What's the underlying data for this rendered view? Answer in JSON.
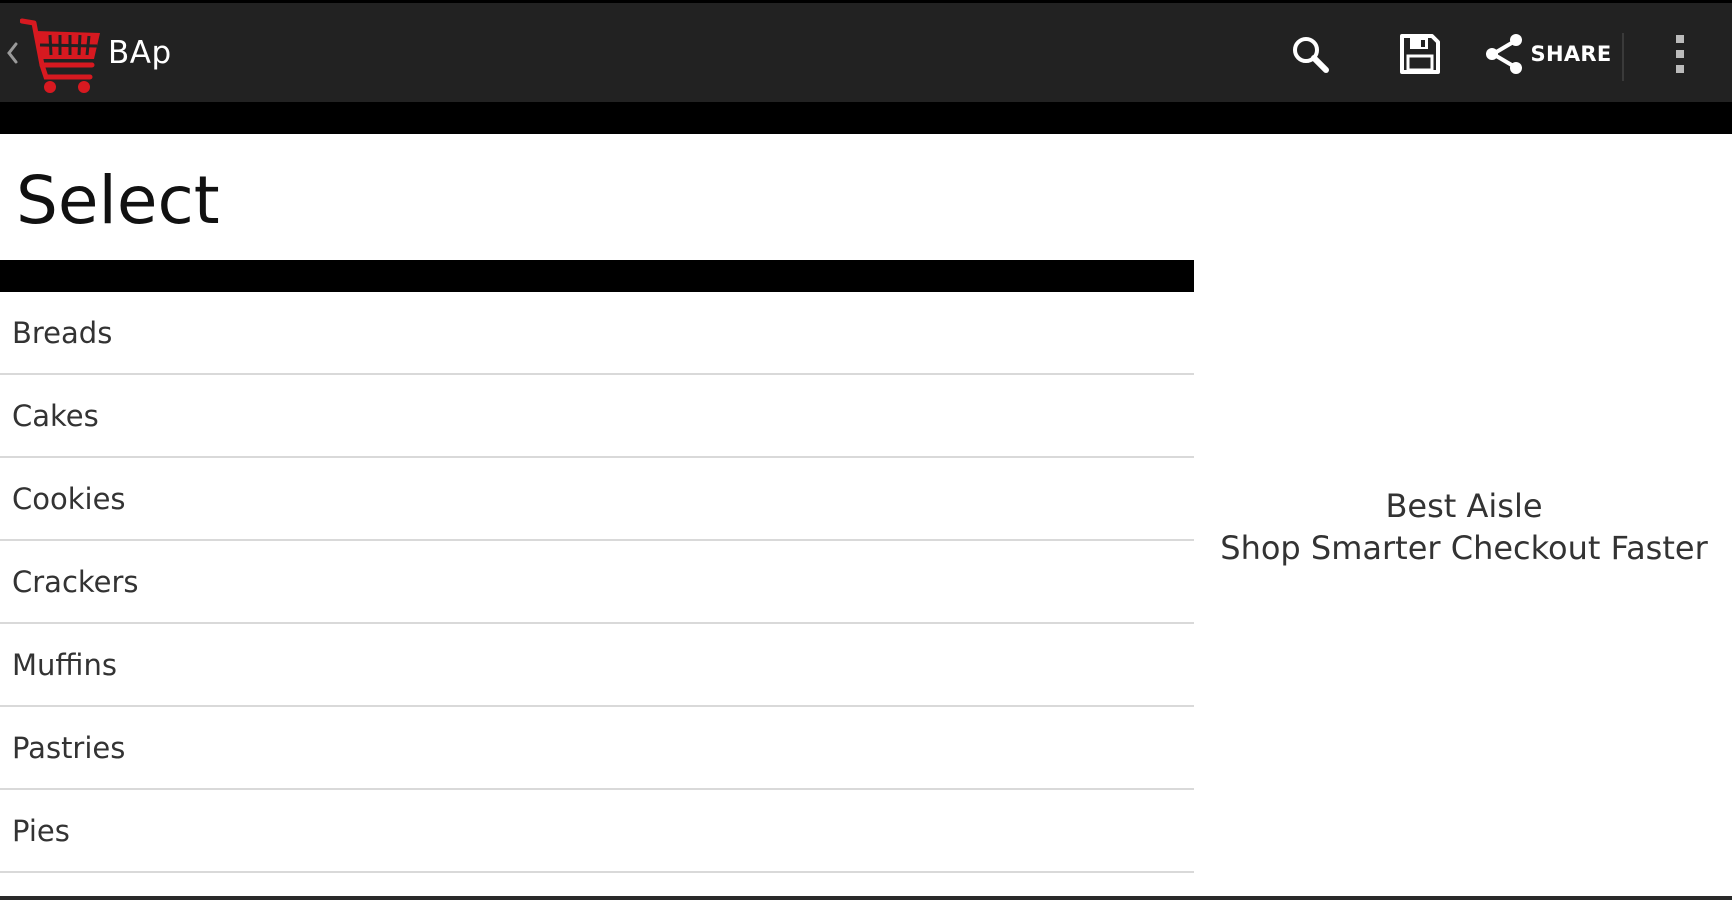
{
  "action_bar": {
    "app_title": "BAp",
    "icons": {
      "back": "chevron-left-icon",
      "logo": "shopping-cart-icon",
      "search": "search-icon",
      "save": "save-icon",
      "share": "share-icon",
      "overflow": "more-vertical-icon"
    },
    "share_label": "SHARE",
    "colors": {
      "background": "#222222",
      "logo": "#d71920",
      "icons": "#ffffff"
    }
  },
  "main": {
    "title": "Select",
    "items": [
      {
        "label": "Breads"
      },
      {
        "label": "Cakes"
      },
      {
        "label": "Cookies"
      },
      {
        "label": "Crackers"
      },
      {
        "label": "Muffins"
      },
      {
        "label": "Pastries"
      },
      {
        "label": "Pies"
      }
    ]
  },
  "side_panel": {
    "line1": "Best Aisle",
    "line2": "Shop Smarter Checkout Faster"
  }
}
